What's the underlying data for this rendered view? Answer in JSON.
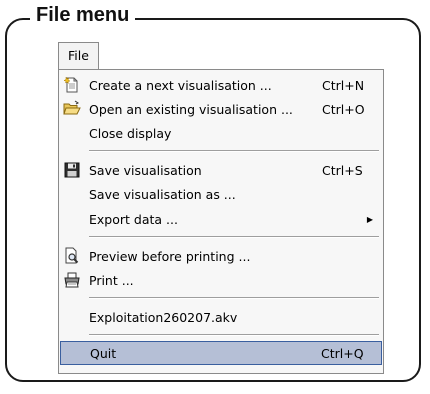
{
  "title": "File menu",
  "menubar": {
    "file_label": "File"
  },
  "menu": {
    "items": [
      {
        "label": "Create a next visualisation ...",
        "shortcut": "Ctrl+N",
        "icon": "new-document-icon"
      },
      {
        "label": "Open an existing visualisation ...",
        "shortcut": "Ctrl+O",
        "icon": "open-folder-icon"
      },
      {
        "label": "Close display",
        "shortcut": ""
      },
      {
        "label": "Save visualisation",
        "shortcut": "Ctrl+S",
        "icon": "floppy-disk-icon"
      },
      {
        "label": "Save visualisation as ...",
        "shortcut": ""
      },
      {
        "label": "Export data ...",
        "shortcut": "",
        "submenu": true
      },
      {
        "label": "Preview before printing ...",
        "shortcut": "",
        "icon": "print-preview-icon"
      },
      {
        "label": "Print ...",
        "shortcut": "",
        "icon": "printer-icon"
      },
      {
        "label": "Exploitation260207.akv",
        "shortcut": ""
      },
      {
        "label": "Quit",
        "shortcut": "Ctrl+Q",
        "highlighted": true
      }
    ]
  },
  "colors": {
    "highlight": "#b5bfd6",
    "highlight_border": "#3a5f9f",
    "menu_bg": "#f7f7f7"
  }
}
